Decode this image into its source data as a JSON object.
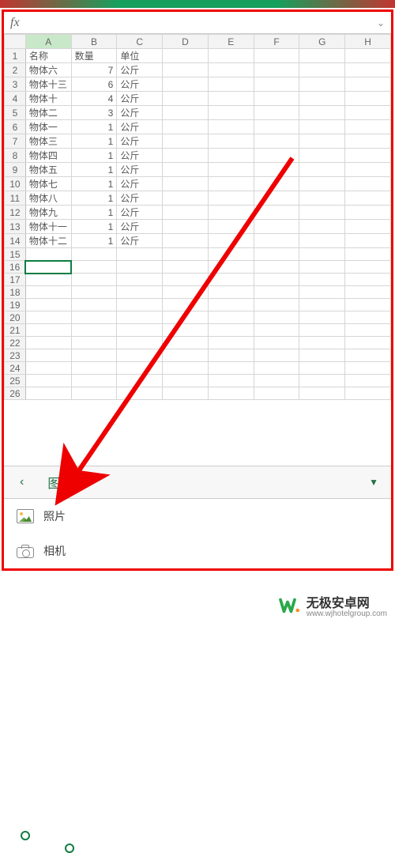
{
  "formula_bar": {
    "fx": "fx",
    "value": ""
  },
  "columns": [
    "A",
    "B",
    "C",
    "D",
    "E",
    "F",
    "G",
    "H"
  ],
  "row_count": 26,
  "selected_cell": "A16",
  "data": {
    "headers": [
      "名称",
      "数量",
      "单位"
    ],
    "rows": [
      {
        "name": "物体六",
        "qty": 7,
        "unit": "公斤"
      },
      {
        "name": "物体十三",
        "qty": 6,
        "unit": "公斤"
      },
      {
        "name": "物体十",
        "qty": 4,
        "unit": "公斤"
      },
      {
        "name": "物体二",
        "qty": 3,
        "unit": "公斤"
      },
      {
        "name": "物体一",
        "qty": 1,
        "unit": "公斤"
      },
      {
        "name": "物体三",
        "qty": 1,
        "unit": "公斤"
      },
      {
        "name": "物体四",
        "qty": 1,
        "unit": "公斤"
      },
      {
        "name": "物体五",
        "qty": 1,
        "unit": "公斤"
      },
      {
        "name": "物体七",
        "qty": 1,
        "unit": "公斤"
      },
      {
        "name": "物体八",
        "qty": 1,
        "unit": "公斤"
      },
      {
        "name": "物体九",
        "qty": 1,
        "unit": "公斤"
      },
      {
        "name": "物体十一",
        "qty": 1,
        "unit": "公斤"
      },
      {
        "name": "物体十二",
        "qty": 1,
        "unit": "公斤"
      }
    ]
  },
  "ribbon": {
    "back": "‹",
    "group_label": "图片",
    "dropdown": "▼"
  },
  "menu": {
    "photos": "照片",
    "camera": "相机"
  },
  "watermark": {
    "title": "无极安卓网",
    "url": "www.wjhotelgroup.com"
  }
}
